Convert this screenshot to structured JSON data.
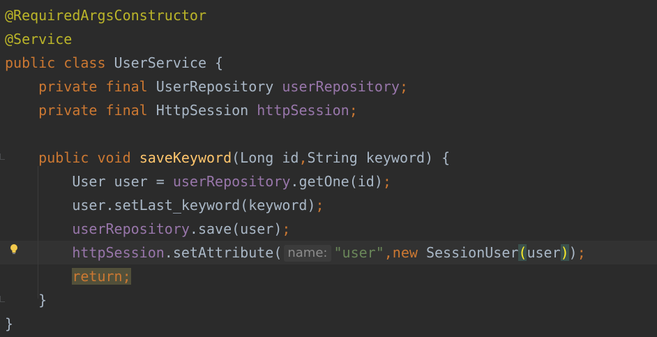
{
  "editor": {
    "lines": [
      [
        {
          "t": "@RequiredArgsConstructor",
          "c": "ann"
        }
      ],
      [
        {
          "t": "@Service",
          "c": "ann"
        }
      ],
      [
        {
          "t": "public ",
          "c": "kw"
        },
        {
          "t": "class ",
          "c": "kw"
        },
        {
          "t": "UserService {",
          "c": "plain"
        }
      ],
      [
        {
          "t": "    "
        },
        {
          "t": "private ",
          "c": "kw"
        },
        {
          "t": "final ",
          "c": "kw"
        },
        {
          "t": "UserRepository ",
          "c": "plain"
        },
        {
          "t": "userRepository",
          "c": "fld"
        },
        {
          "t": ";",
          "c": "kw"
        }
      ],
      [
        {
          "t": "    "
        },
        {
          "t": "private ",
          "c": "kw"
        },
        {
          "t": "final ",
          "c": "kw"
        },
        {
          "t": "HttpSession ",
          "c": "plain"
        },
        {
          "t": "httpSession",
          "c": "fld"
        },
        {
          "t": ";",
          "c": "kw"
        }
      ],
      [],
      [
        {
          "t": "    "
        },
        {
          "t": "public ",
          "c": "kw"
        },
        {
          "t": "void ",
          "c": "kw"
        },
        {
          "t": "saveKeyword",
          "c": "fn"
        },
        {
          "t": "(Long id",
          "c": "plain"
        },
        {
          "t": ",",
          "c": "kw"
        },
        {
          "t": "String keyword) {",
          "c": "plain"
        }
      ],
      [
        {
          "t": "        "
        },
        {
          "t": "User user = ",
          "c": "plain"
        },
        {
          "t": "userRepository",
          "c": "fld"
        },
        {
          "t": ".getOne(id)",
          "c": "plain"
        },
        {
          "t": ";",
          "c": "kw"
        }
      ],
      [
        {
          "t": "        "
        },
        {
          "t": "user.setLast_keyword(keyword)",
          "c": "plain"
        },
        {
          "t": ";",
          "c": "kw"
        }
      ],
      [
        {
          "t": "        "
        },
        {
          "t": "userRepository",
          "c": "fld"
        },
        {
          "t": ".save(user)",
          "c": "plain"
        },
        {
          "t": ";",
          "c": "kw"
        }
      ],
      [
        {
          "t": "        "
        },
        {
          "t": "httpSession",
          "c": "fld"
        },
        {
          "t": ".setAttribute(",
          "c": "plain"
        },
        {
          "t": "name:",
          "c": "hint"
        },
        {
          "t": "\"user\"",
          "c": "str"
        },
        {
          "t": ",",
          "c": "kw"
        },
        {
          "t": "new ",
          "c": "kw"
        },
        {
          "t": "SessionUser",
          "c": "plain"
        },
        {
          "t": "(",
          "c": "brace-match"
        },
        {
          "t": "user",
          "c": "plain"
        },
        {
          "t": ")",
          "c": "brace-match"
        },
        {
          "t": ")",
          "c": "plain"
        },
        {
          "t": ";",
          "c": "kw"
        }
      ],
      [
        {
          "t": "        "
        },
        {
          "t": "return;",
          "c": "kw ret-hl"
        }
      ],
      [
        {
          "t": "    "
        },
        {
          "t": "}",
          "c": "plain"
        }
      ],
      [
        {
          "t": "}",
          "c": "plain"
        }
      ]
    ],
    "current_line": 10
  },
  "icons": {
    "bulb": "lightbulb-icon"
  }
}
